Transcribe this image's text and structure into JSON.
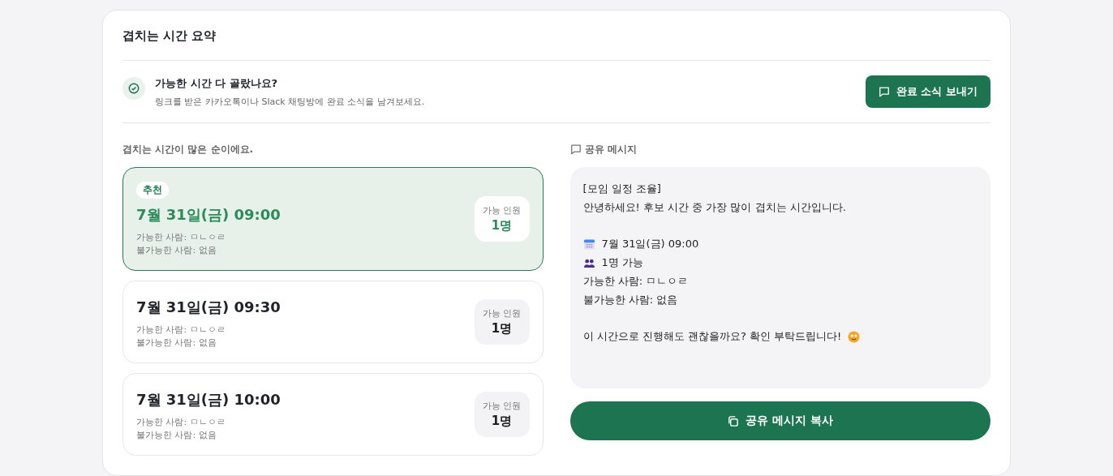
{
  "title": "겹치는 시간 요약",
  "notice": {
    "title": "가능한 시간 다 골랐나요?",
    "description": "링크를 받은 카카오톡이나 Slack 채팅방에 완료 소식을 남겨보세요.",
    "button": "완료 소식 보내기"
  },
  "ranking": {
    "heading": "겹치는 시간이 많은 순이에요.",
    "slots": [
      {
        "selected": true,
        "badge": "추천",
        "time": "7월 31일(금) 09:00",
        "available": "가능한 사람: ㅁㄴㅇㄹ",
        "unavailable": "불가능한 사람: 없음",
        "count_label": "가능 인원",
        "count": "1명"
      },
      {
        "selected": false,
        "time": "7월 31일(금) 09:30",
        "available": "가능한 사람: ㅁㄴㅇㄹ",
        "unavailable": "불가능한 사람: 없음",
        "count_label": "가능 인원",
        "count": "1명"
      },
      {
        "selected": false,
        "time": "7월 31일(금) 10:00",
        "available": "가능한 사람: ㅁㄴㅇㄹ",
        "unavailable": "불가능한 사람: 없음",
        "count_label": "가능 인원",
        "count": "1명"
      }
    ]
  },
  "share": {
    "heading": "공유 메시지",
    "lines": [
      {
        "kind": "text",
        "text": "[모임 일정 조율]"
      },
      {
        "kind": "text",
        "text": "안녕하세요! 후보 시간 중 가장 많이 겹치는 시간입니다."
      },
      {
        "kind": "blank"
      },
      {
        "kind": "calendar",
        "text": "7월 31일(금) 09:00"
      },
      {
        "kind": "people",
        "text": "1명 가능"
      },
      {
        "kind": "text",
        "text": "가능한 사람: ㅁㄴㅇㄹ"
      },
      {
        "kind": "text",
        "text": "불가능한 사람: 없음"
      },
      {
        "kind": "blank"
      },
      {
        "kind": "smile",
        "text": "이 시간으로 진행해도 괜찮을까요? 확인 부탁드립니다!"
      }
    ],
    "button": "공유 메시지 복사"
  }
}
